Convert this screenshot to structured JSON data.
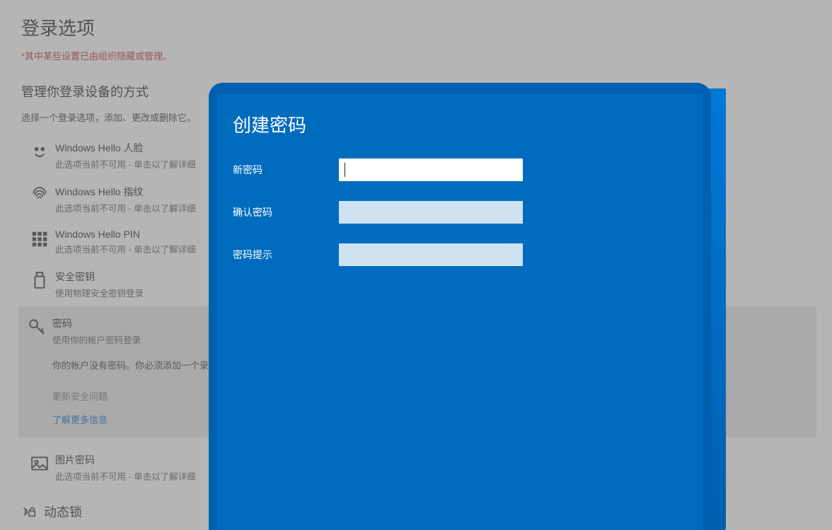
{
  "page": {
    "title": "登录选项",
    "managed_warning": "*其中某些设置已由组织隐藏或管理。",
    "manage_heading": "管理你登录设备的方式",
    "manage_subtext": "选择一个登录选项，添加、更改或删除它。"
  },
  "options": {
    "face": {
      "title": "Windows Hello 人脸",
      "sub": "此选项当前不可用 - 单击以了解详细"
    },
    "fingerprint": {
      "title": "Windows Hello 指纹",
      "sub": "此选项当前不可用 - 单击以了解详细"
    },
    "pin": {
      "title": "Windows Hello PIN",
      "sub": "此选项当前不可用 - 单击以了解详细"
    },
    "security_key": {
      "title": "安全密钥",
      "sub": "使用物理安全密钥登录"
    },
    "password": {
      "title": "密码",
      "sub": "使用你的帐户密码登录",
      "no_password_text": "你的帐户没有密码。你必须添加一个录选项。",
      "update_questions": "更新安全问题",
      "learn_more": "了解更多信息"
    },
    "picture": {
      "title": "图片密码",
      "sub": "此选项当前不可用 - 单击以了解详细"
    }
  },
  "dynamic_lock": {
    "heading": "动态锁"
  },
  "dialog": {
    "title": "创建密码",
    "new_password_label": "新密码",
    "confirm_password_label": "确认密码",
    "hint_label": "密码提示",
    "new_password_value": "",
    "confirm_password_value": "",
    "hint_value": ""
  }
}
